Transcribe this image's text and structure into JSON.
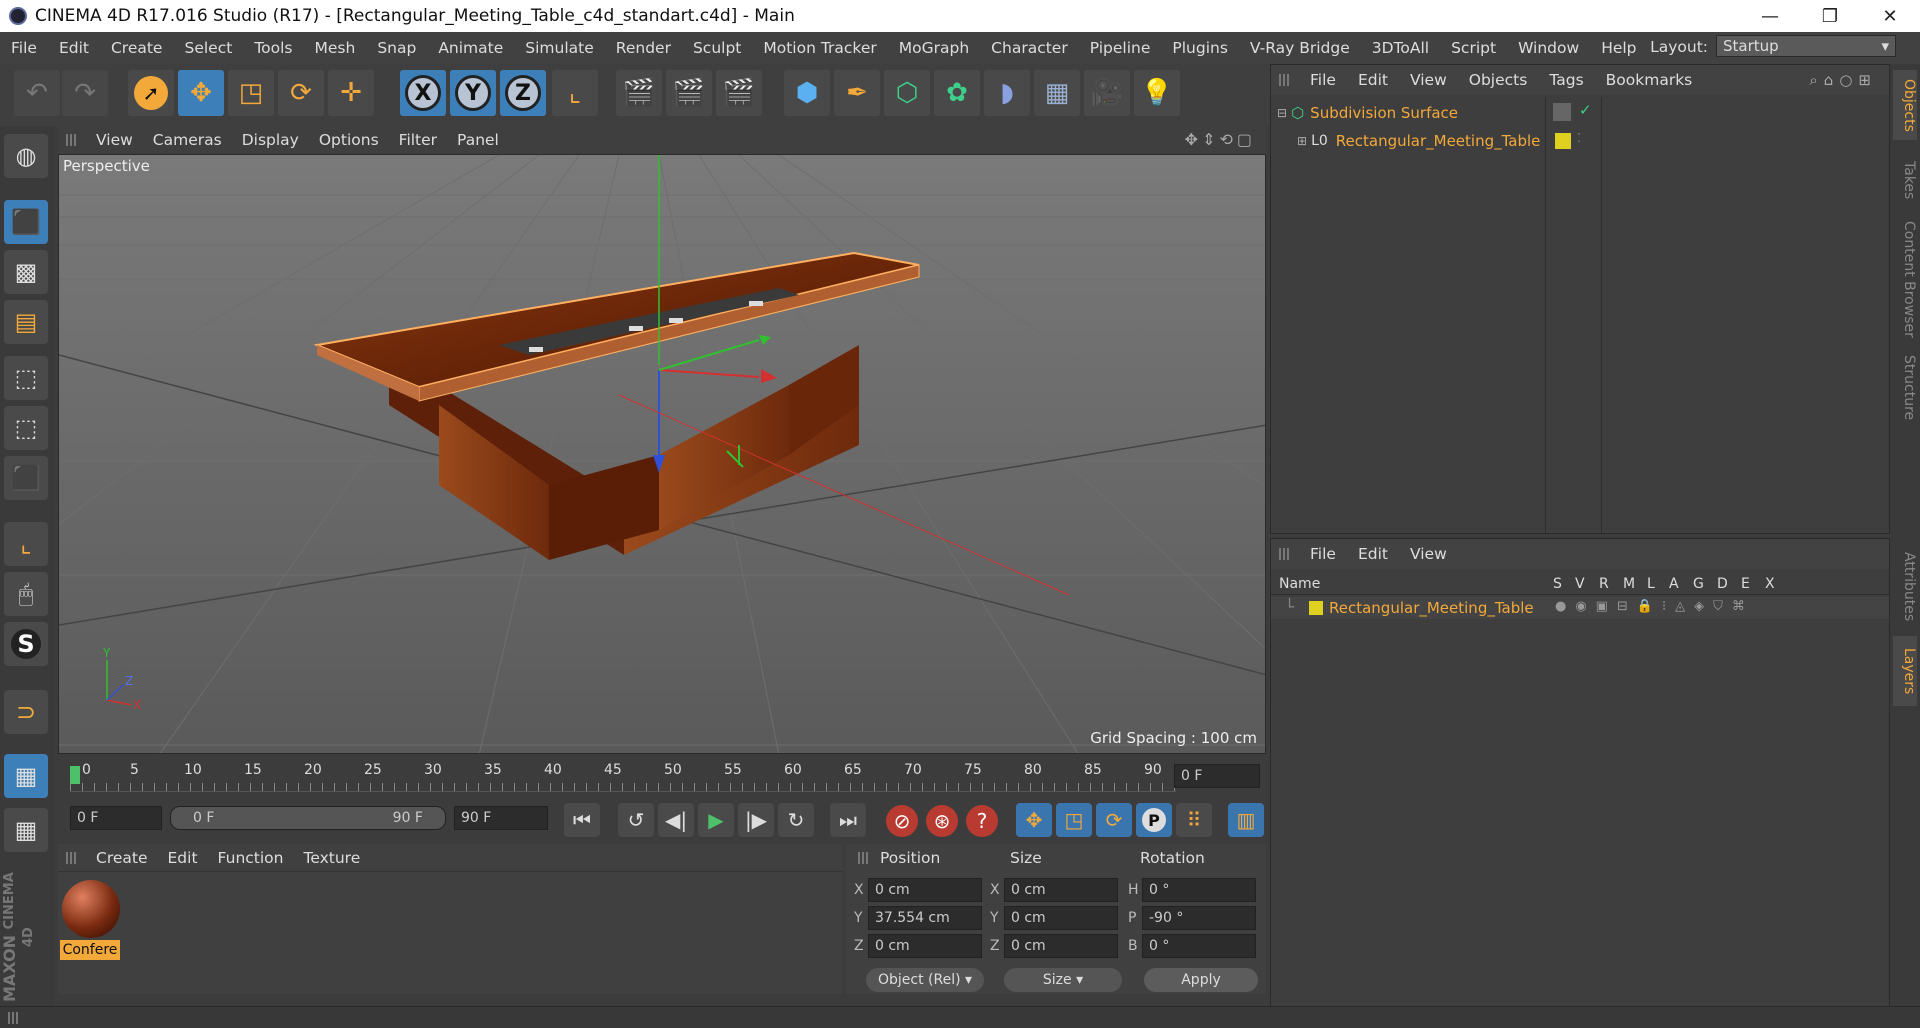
{
  "window": {
    "title": "CINEMA 4D R17.016 Studio (R17) - [Rectangular_Meeting_Table_c4d_standart.c4d] - Main",
    "minimize": "—",
    "maximize": "❐",
    "close": "✕"
  },
  "menubar": {
    "items": [
      "File",
      "Edit",
      "Create",
      "Select",
      "Tools",
      "Mesh",
      "Snap",
      "Animate",
      "Simulate",
      "Render",
      "Sculpt",
      "Motion Tracker",
      "MoGraph",
      "Character",
      "Pipeline",
      "Plugins",
      "V-Ray Bridge",
      "3DToAll",
      "Script",
      "Window",
      "Help"
    ],
    "layout_label": "Layout:",
    "layout_value": "Startup"
  },
  "viewport": {
    "menu": [
      "View",
      "Cameras",
      "Display",
      "Options",
      "Filter",
      "Panel"
    ],
    "label": "Perspective",
    "grid_spacing": "Grid Spacing : 100 cm"
  },
  "timeline": {
    "ticks": [
      "0",
      "5",
      "10",
      "15",
      "20",
      "25",
      "30",
      "35",
      "40",
      "45",
      "50",
      "55",
      "60",
      "65",
      "70",
      "75",
      "80",
      "85",
      "90"
    ],
    "current_frame": "0 F",
    "start": "0 F",
    "range_start": "0 F",
    "range_end": "90 F",
    "end": "90 F"
  },
  "material_panel": {
    "menu": [
      "Create",
      "Edit",
      "Function",
      "Texture"
    ],
    "material_name": "Confere"
  },
  "coords": {
    "headers": [
      "Position",
      "Size",
      "Rotation"
    ],
    "pos": {
      "x": "0 cm",
      "y": "37.554 cm",
      "z": "0 cm"
    },
    "size": {
      "x": "0 cm",
      "y": "0 cm",
      "z": "0 cm"
    },
    "rot": {
      "h": "0 °",
      "p": "-90 °",
      "b": "0 °"
    },
    "labels": {
      "x": "X",
      "y": "Y",
      "z": "Z",
      "h": "H",
      "p": "P",
      "b": "B"
    },
    "mode": "Object (Rel)",
    "size_mode": "Size",
    "apply": "Apply"
  },
  "object_manager": {
    "menu": [
      "File",
      "Edit",
      "View",
      "Objects",
      "Tags",
      "Bookmarks"
    ],
    "objects": [
      {
        "name": "Subdivision Surface"
      },
      {
        "name": "Rectangular_Meeting_Table"
      }
    ]
  },
  "layer_manager": {
    "menu": [
      "File",
      "Edit",
      "View"
    ],
    "columns": [
      "Name",
      "S",
      "V",
      "R",
      "M",
      "L",
      "A",
      "G",
      "D",
      "E",
      "X"
    ],
    "layers": [
      {
        "name": "Rectangular_Meeting_Table"
      }
    ]
  },
  "right_tabs": [
    "Objects",
    "Takes",
    "Content Browser",
    "Structure",
    "Attributes",
    "Layers"
  ],
  "brand": {
    "maxon": "MAXON",
    "product": "CINEMA 4D"
  },
  "colors": {
    "accent": "#f3a93a",
    "selection_blue": "#3d7fb8",
    "axis_x": "#d43030",
    "axis_y": "#30c030",
    "axis_z": "#3050d8"
  }
}
